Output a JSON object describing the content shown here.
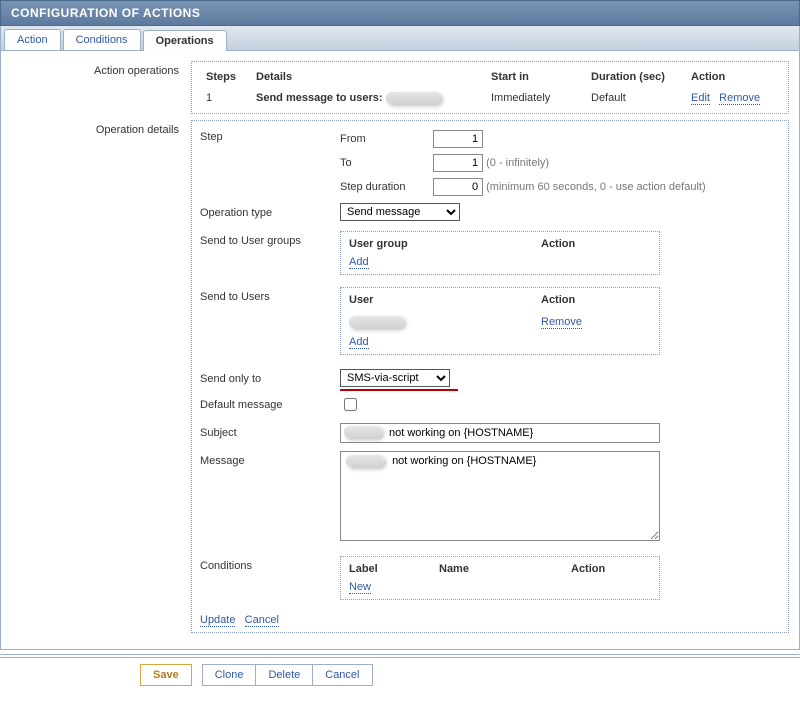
{
  "header": {
    "title": "CONFIGURATION OF ACTIONS"
  },
  "tabs": {
    "action": "Action",
    "conditions": "Conditions",
    "operations": "Operations"
  },
  "operations_table": {
    "label": "Action operations",
    "headers": {
      "steps": "Steps",
      "details": "Details",
      "start_in": "Start in",
      "duration": "Duration (sec)",
      "action": "Action"
    },
    "row": {
      "step": "1",
      "details_prefix": "Send message to users:",
      "start_in": "Immediately",
      "duration": "Default",
      "edit": "Edit",
      "remove": "Remove"
    }
  },
  "details": {
    "label": "Operation details",
    "step_label": "Step",
    "from_label": "From",
    "from_value": "1",
    "to_label": "To",
    "to_value": "1",
    "to_hint": "(0 - infinitely)",
    "stepdur_label": "Step duration",
    "stepdur_value": "0",
    "stepdur_hint": "(minimum 60 seconds, 0 - use action default)",
    "optype_label": "Operation type",
    "optype_value": "Send message",
    "groups_label": "Send to User groups",
    "groups_head1": "User group",
    "groups_head2": "Action",
    "groups_add": "Add",
    "users_label": "Send to Users",
    "users_head1": "User",
    "users_head2": "Action",
    "users_remove": "Remove",
    "users_add": "Add",
    "sendonly_label": "Send only to",
    "sendonly_value": "SMS-via-script",
    "defmsg_label": "Default message",
    "subject_label": "Subject",
    "subject_value_suffix": "not working on {HOSTNAME}",
    "message_label": "Message",
    "message_value_suffix": " not working on {HOSTNAME}",
    "conditions_label": "Conditions",
    "cond_head1": "Label",
    "cond_head2": "Name",
    "cond_head3": "Action",
    "cond_new": "New",
    "update": "Update",
    "cancel": "Cancel"
  },
  "footer": {
    "save": "Save",
    "clone": "Clone",
    "delete": "Delete",
    "cancel": "Cancel"
  }
}
